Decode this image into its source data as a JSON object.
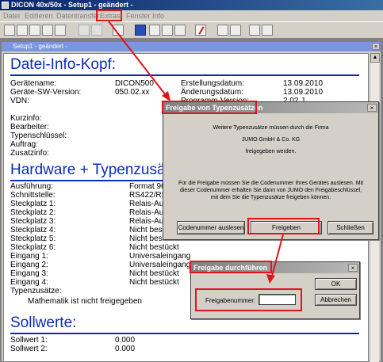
{
  "app": {
    "title": "DICON 40x/50x - Setup1 - geändert -"
  },
  "menu": {
    "items": [
      "Datei",
      "Editieren",
      "Datentransfer",
      "Extras",
      "Fenster",
      "Info"
    ]
  },
  "document": {
    "title": "Setup1 - geändert -",
    "section1": {
      "heading": "Datei-Info-Kopf:",
      "fields": [
        {
          "label": "Gerätename:",
          "value": "DICON500"
        },
        {
          "label": "Geräte-SW-Version:",
          "value": "050.02.xx"
        },
        {
          "label": "VDN:",
          "value": ""
        }
      ],
      "right_fields": [
        {
          "label": "Erstellungsdatum:",
          "value": "13.09.2010"
        },
        {
          "label": "Änderungsdatum:",
          "value": "13.09.2010"
        },
        {
          "label": "Programm-Version:",
          "value": "2.02 J"
        }
      ],
      "info_labels": [
        "Kurzinfo:",
        "Bearbeiter:",
        "Typenschlüssel:",
        "Auftrag:",
        "Zusatzinfo:"
      ]
    },
    "section2": {
      "heading": "Hardware + Typenzusätze:",
      "rows": [
        {
          "label": "Ausführung:",
          "value": "Format 96"
        },
        {
          "label": "Schnittstelle:",
          "value": "RS422/RS"
        },
        {
          "label": "Steckplatz 1:",
          "value": "Relais-Aus"
        },
        {
          "label": "Steckplatz 2:",
          "value": "Relais-Aus"
        },
        {
          "label": "Steckplatz 3:",
          "value": "Relais-Aus"
        },
        {
          "label": "Steckplatz 4:",
          "value": "Nicht best"
        },
        {
          "label": "Steckplatz 5:",
          "value": "Nicht best"
        },
        {
          "label": "Steckplatz 6:",
          "value": "Nicht bestückt"
        },
        {
          "label": "Eingang 1:",
          "value": "Universaleingang"
        },
        {
          "label": "Eingang 2:",
          "value": "Universaleingang"
        },
        {
          "label": "Eingang 3:",
          "value": "Nicht bestückt"
        },
        {
          "label": "Eingang 4:",
          "value": "Nicht bestückt"
        },
        {
          "label": "Typenzusätze:",
          "value": ""
        }
      ],
      "note": "Mathematik ist nicht freigegeben"
    },
    "section3": {
      "heading": "Sollwerte:",
      "rows": [
        {
          "label": "Sollwert 1:",
          "value": "0.000"
        },
        {
          "label": "Sollwert 2:",
          "value": "0.000"
        }
      ]
    }
  },
  "dialog1": {
    "title": "Freigabe von Typenzusätzen",
    "line1": "Weitere Typenzusätze müssen durch die Firma",
    "line2": "JUMO GmbH & Co. KG",
    "line3": "freigegeben werden.",
    "info1": "Für die Freigabe müssen Sie die Codenummer Ihres Gerätes auslesen. Mit",
    "info2": "dieser Codenummer erhalten Sie dann von JUMO den Freigabeschlüssel,",
    "info3": "mit dem Sie die Typenzusätze freigeben können.",
    "btn_read": "Codenummer auslesen",
    "btn_release": "Freigeben",
    "btn_close": "Schließen",
    "close_glyph": "×"
  },
  "dialog2": {
    "title": "Freigabe durchführen",
    "field_label": "Freigabenummer:",
    "field_value": "",
    "btn_ok": "OK",
    "btn_cancel": "Abbrechen",
    "close_glyph": "×"
  },
  "colors": {
    "heading": "#0a2db5",
    "highlight": "#e0141e"
  }
}
